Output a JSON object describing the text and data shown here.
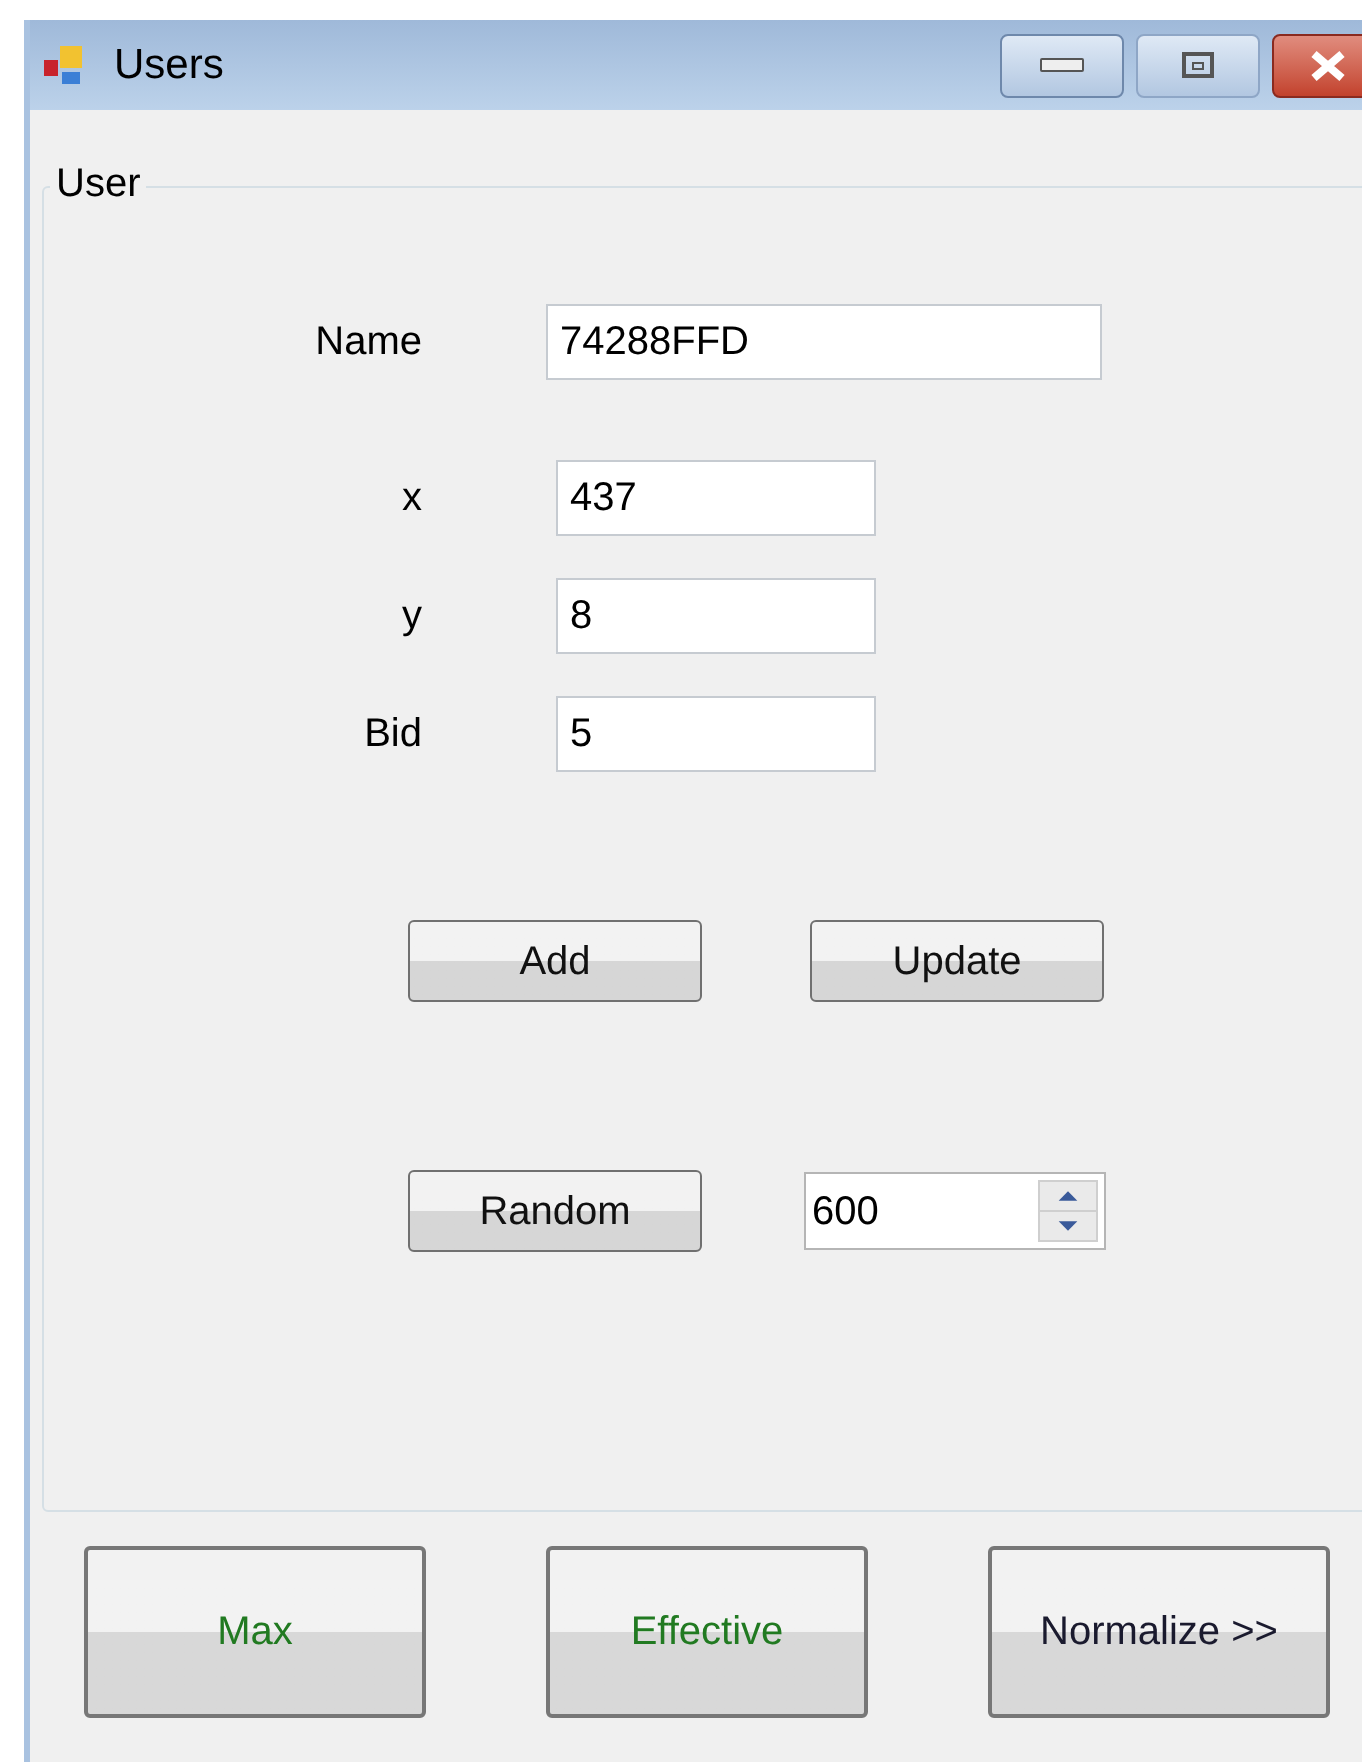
{
  "window": {
    "title": "Users"
  },
  "group": {
    "title": "User"
  },
  "fields": [
    {
      "label": "Name",
      "value": "74288FFD",
      "kind": "wide"
    },
    {
      "label": "x",
      "value": "437",
      "kind": "narrow"
    },
    {
      "label": "y",
      "value": "8",
      "kind": "narrow"
    },
    {
      "label": "Bid",
      "value": "5",
      "kind": "narrow"
    }
  ],
  "action_buttons": [
    "Add",
    "Update"
  ],
  "random_button": "Random",
  "spinner": {
    "value": "600"
  },
  "bottom_buttons": [
    {
      "label": "Max",
      "color": "#217a21"
    },
    {
      "label": "Effective",
      "color": "#217a21"
    },
    {
      "label": "Normalize >>",
      "color": "#1a1a2e"
    }
  ]
}
